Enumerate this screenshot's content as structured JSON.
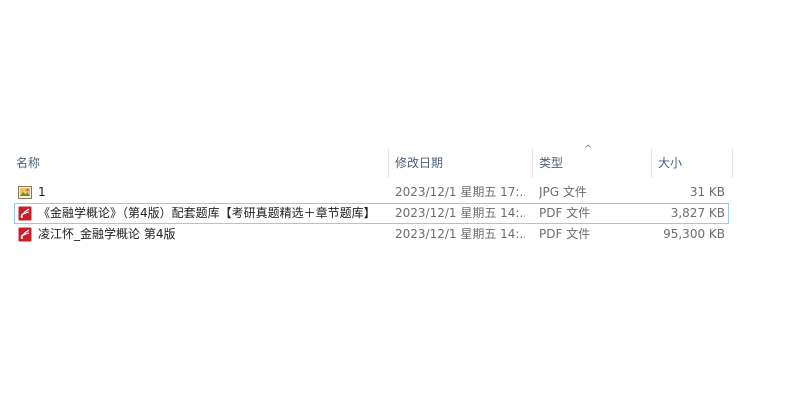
{
  "columns": {
    "name": "名称",
    "date": "修改日期",
    "type": "类型",
    "size": "大小",
    "sort_indicator": "^"
  },
  "files": [
    {
      "icon": "jpg-file-icon",
      "name": "1",
      "date": "2023/12/1 星期五 17:...",
      "type": "JPG 文件",
      "size": "31 KB"
    },
    {
      "icon": "pdf-file-icon",
      "name": "《金融学概论》（第4版）配套题库【考研真题精选＋章节题库】",
      "date": "2023/12/1 星期五 14:...",
      "type": "PDF 文件",
      "size": "3,827 KB"
    },
    {
      "icon": "pdf-file-icon",
      "name": "凌江怀_金融学概论 第4版",
      "date": "2023/12/1 星期五 14:...",
      "type": "PDF 文件",
      "size": "95,300 KB"
    }
  ],
  "colors": {
    "header_text": "#4c607a",
    "detail_text": "#6d6d6d",
    "focus_outline": "#99c9ef",
    "pdf_icon": "#c8202a"
  }
}
